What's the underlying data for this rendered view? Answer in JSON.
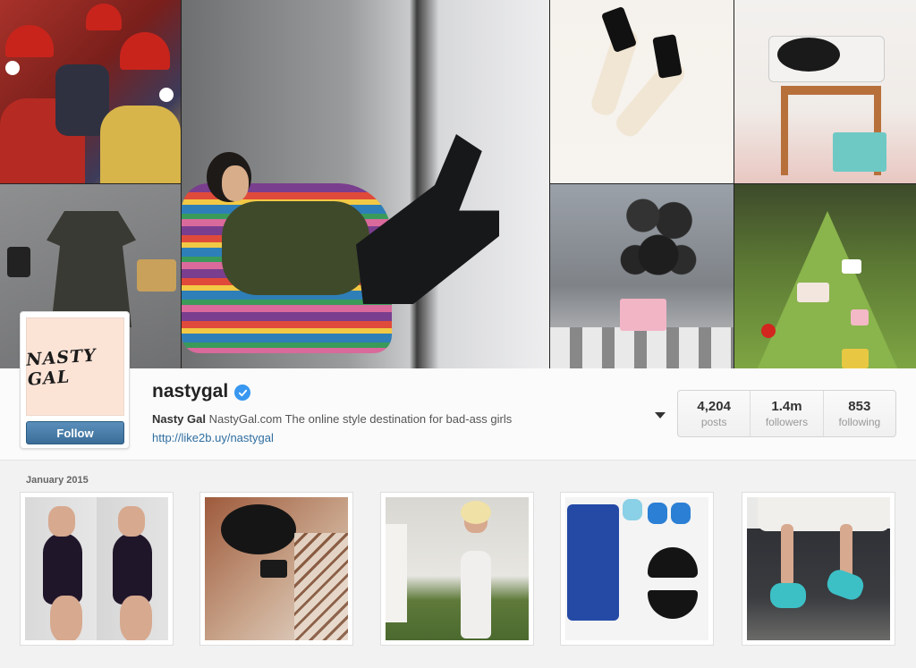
{
  "profile": {
    "username": "nastygal",
    "avatar_logo_text": "NASTY GAL",
    "display_name": "Nasty Gal",
    "bio": "NastyGal.com The online style destination for bad-ass girls",
    "link": "http://like2b.uy/nastygal",
    "follow_label": "Follow",
    "verified_icon": "verified-badge-icon"
  },
  "stats": [
    {
      "value": "4,204",
      "label": "posts"
    },
    {
      "value": "1.4m",
      "label": "followers"
    },
    {
      "value": "853",
      "label": "following"
    }
  ],
  "posts_section": {
    "month_label": "January 2015",
    "post_count": 5
  },
  "colors": {
    "follow_button": "#3b6d98",
    "link": "#2f6ea0",
    "verified": "#3897f0"
  }
}
